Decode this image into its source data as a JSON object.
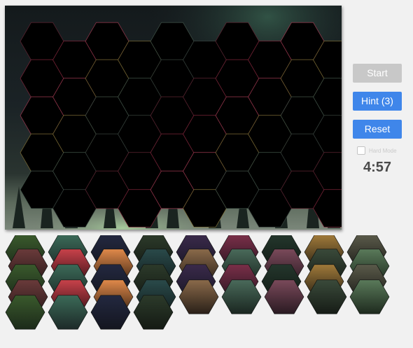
{
  "controls": {
    "start_label": "Start",
    "hint_label": "Hint (3)",
    "reset_label": "Reset",
    "hard_mode_label": "Hard Mode",
    "hard_mode_checked": false,
    "timer": "4:57",
    "colors": {
      "start_disabled": "#c8c8c8",
      "accent_blue": "#3f86ea",
      "timer_text": "#4a4a4a"
    }
  },
  "puzzle": {
    "image_theme": "aurora over snowy forest at night",
    "board_rows": 5,
    "board_columns": 10,
    "empty_slot_color": "#000000",
    "placed_pieces": 0,
    "tray_pieces": 40
  }
}
